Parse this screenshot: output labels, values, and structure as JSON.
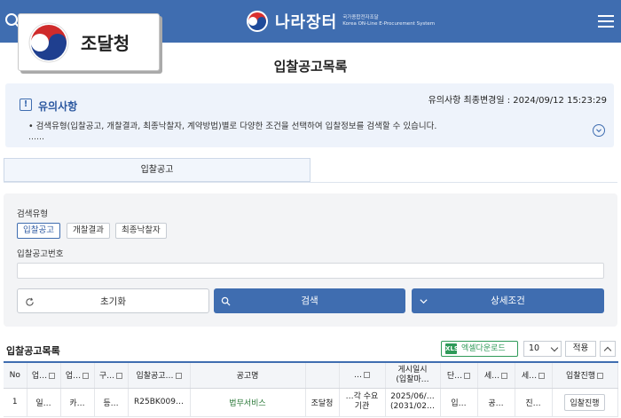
{
  "header": {
    "brand_name": "나라장터",
    "brand_sub": "국가종합전자조달",
    "brand_sub2": "Korea ON-Line E-Procurement System"
  },
  "agency": {
    "label": "조달청"
  },
  "page_title": "입찰공고목록",
  "notice": {
    "title": "유의사항",
    "mark": "!",
    "updated": "유의사항 최종변경일 : 2024/09/12 15:23:29",
    "body": "• 검색유형(입찰공고, 개찰결과, 최종낙찰자, 계약방법)별로 다양한 조건을 선택하여 입찰정보를 검색할 수 있습니다.",
    "more": "……"
  },
  "tab": {
    "label": "입찰공고"
  },
  "search": {
    "type_label": "검색유형",
    "types": [
      "입찰공고",
      "개찰결과",
      "최종낙찰자"
    ],
    "number_label": "입찰공고번호",
    "reset_label": "초기화",
    "search_label": "검색",
    "detail_label": "상세조건"
  },
  "list": {
    "title": "입찰공고목록",
    "excel_label": "엑셀다운로드",
    "excel_icon": "XLS",
    "page_size": "10",
    "apply_label": "적용"
  },
  "table": {
    "headers": [
      "No",
      "업…",
      "업…",
      "구…",
      "입찰공고…",
      "공고명",
      "…",
      "게시일시\n(입찰마…",
      "단…",
      "세…",
      "세…",
      "입찰진행"
    ],
    "rows": [
      [
        "1",
        "일…",
        "카…",
        "등…",
        "R25BK009…",
        "법무서비스",
        "조달청",
        "…각 수요\n기관",
        "2025/06/…\n(2031/02…",
        "입…",
        "공…",
        "진…",
        "입찰진행"
      ]
    ]
  },
  "colors": {
    "primary": "#3f6db0",
    "excel": "#2f9a59"
  }
}
